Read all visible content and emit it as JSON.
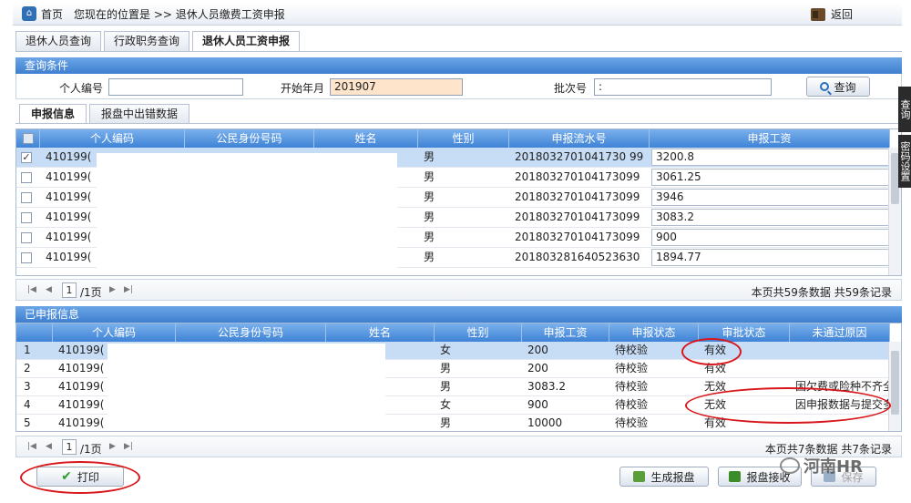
{
  "breadcrumb": {
    "home": "首页",
    "location": "您现在的位置是 >> 退休人员缴费工资申报",
    "back": "返回"
  },
  "main_tabs": [
    "退休人员查询",
    "行政职务查询",
    "退休人员工资申报"
  ],
  "query": {
    "title": "查询条件",
    "person_id_label": "个人编号",
    "person_id_value": "",
    "start_month_label": "开始年月",
    "start_month_value": "201907",
    "batch_label": "批次号",
    "batch_value": ":",
    "search_button": "查询"
  },
  "sub_tabs": [
    "申报信息",
    "报盘中出错数据"
  ],
  "declare_grid": {
    "columns": [
      "个人编码",
      "公民身份号码",
      "姓名",
      "性别",
      "申报流水号",
      "申报工资"
    ],
    "rows": [
      {
        "checked": "✓",
        "id": "410199(",
        "gender": "男",
        "serial": "2018032701041730 99",
        "wage": "3200.8"
      },
      {
        "checked": "",
        "id": "410199(",
        "gender": "男",
        "serial": "201803270104173099",
        "wage": "3061.25"
      },
      {
        "checked": "",
        "id": "410199(",
        "gender": "男",
        "serial": "201803270104173099",
        "wage": "3946"
      },
      {
        "checked": "",
        "id": "410199(",
        "gender": "男",
        "serial": "201803270104173099",
        "wage": "3083.2"
      },
      {
        "checked": "",
        "id": "410199(",
        "gender": "男",
        "serial": "201803270104173099",
        "wage": "900"
      },
      {
        "checked": "",
        "id": "410199(",
        "gender": "男",
        "serial": "201803281640523630",
        "wage": "1894.77"
      }
    ]
  },
  "pager1": {
    "page": "1",
    "total_pages": "/1页",
    "info": "本页共59条数据 共59条记录"
  },
  "declared": {
    "title": "已申报信息",
    "columns": [
      "个人编码",
      "公民身份号码",
      "姓名",
      "性别",
      "申报工资",
      "申报状态",
      "审批状态",
      "未通过原因"
    ],
    "rows": [
      {
        "no": "1",
        "id": "410199(",
        "gender": "女",
        "wage": "200",
        "status": "待校验",
        "approval": "有效",
        "reason": ""
      },
      {
        "no": "2",
        "id": "410199(",
        "gender": "男",
        "wage": "200",
        "status": "待校验",
        "approval": "有效",
        "reason": ""
      },
      {
        "no": "3",
        "id": "410199(",
        "gender": "男",
        "wage": "3083.2",
        "status": "待校验",
        "approval": "无效",
        "reason": "因欠费或险种不齐全"
      },
      {
        "no": "4",
        "id": "410199(",
        "gender": "女",
        "wage": "900",
        "status": "待校验",
        "approval": "无效",
        "reason": "因申报数据与提交多"
      },
      {
        "no": "5",
        "id": "410199(",
        "gender": "男",
        "wage": "10000",
        "status": "待校验",
        "approval": "有效",
        "reason": ""
      }
    ]
  },
  "pager2": {
    "page": "1",
    "total_pages": "/1页",
    "info": "本页共7条数据 共7条记录"
  },
  "buttons": {
    "print": "打印",
    "generate": "生成报盘",
    "receive": "报盘接收",
    "save": "保存"
  },
  "side_tools": [
    "查询",
    "密码设置"
  ],
  "watermark": "河南HR",
  "colors": {
    "header_blue": "#3f83d6",
    "annotation_red": "#d8161b",
    "highlight_input": "#fde4cb",
    "selected_row": "#c7dcf5"
  }
}
